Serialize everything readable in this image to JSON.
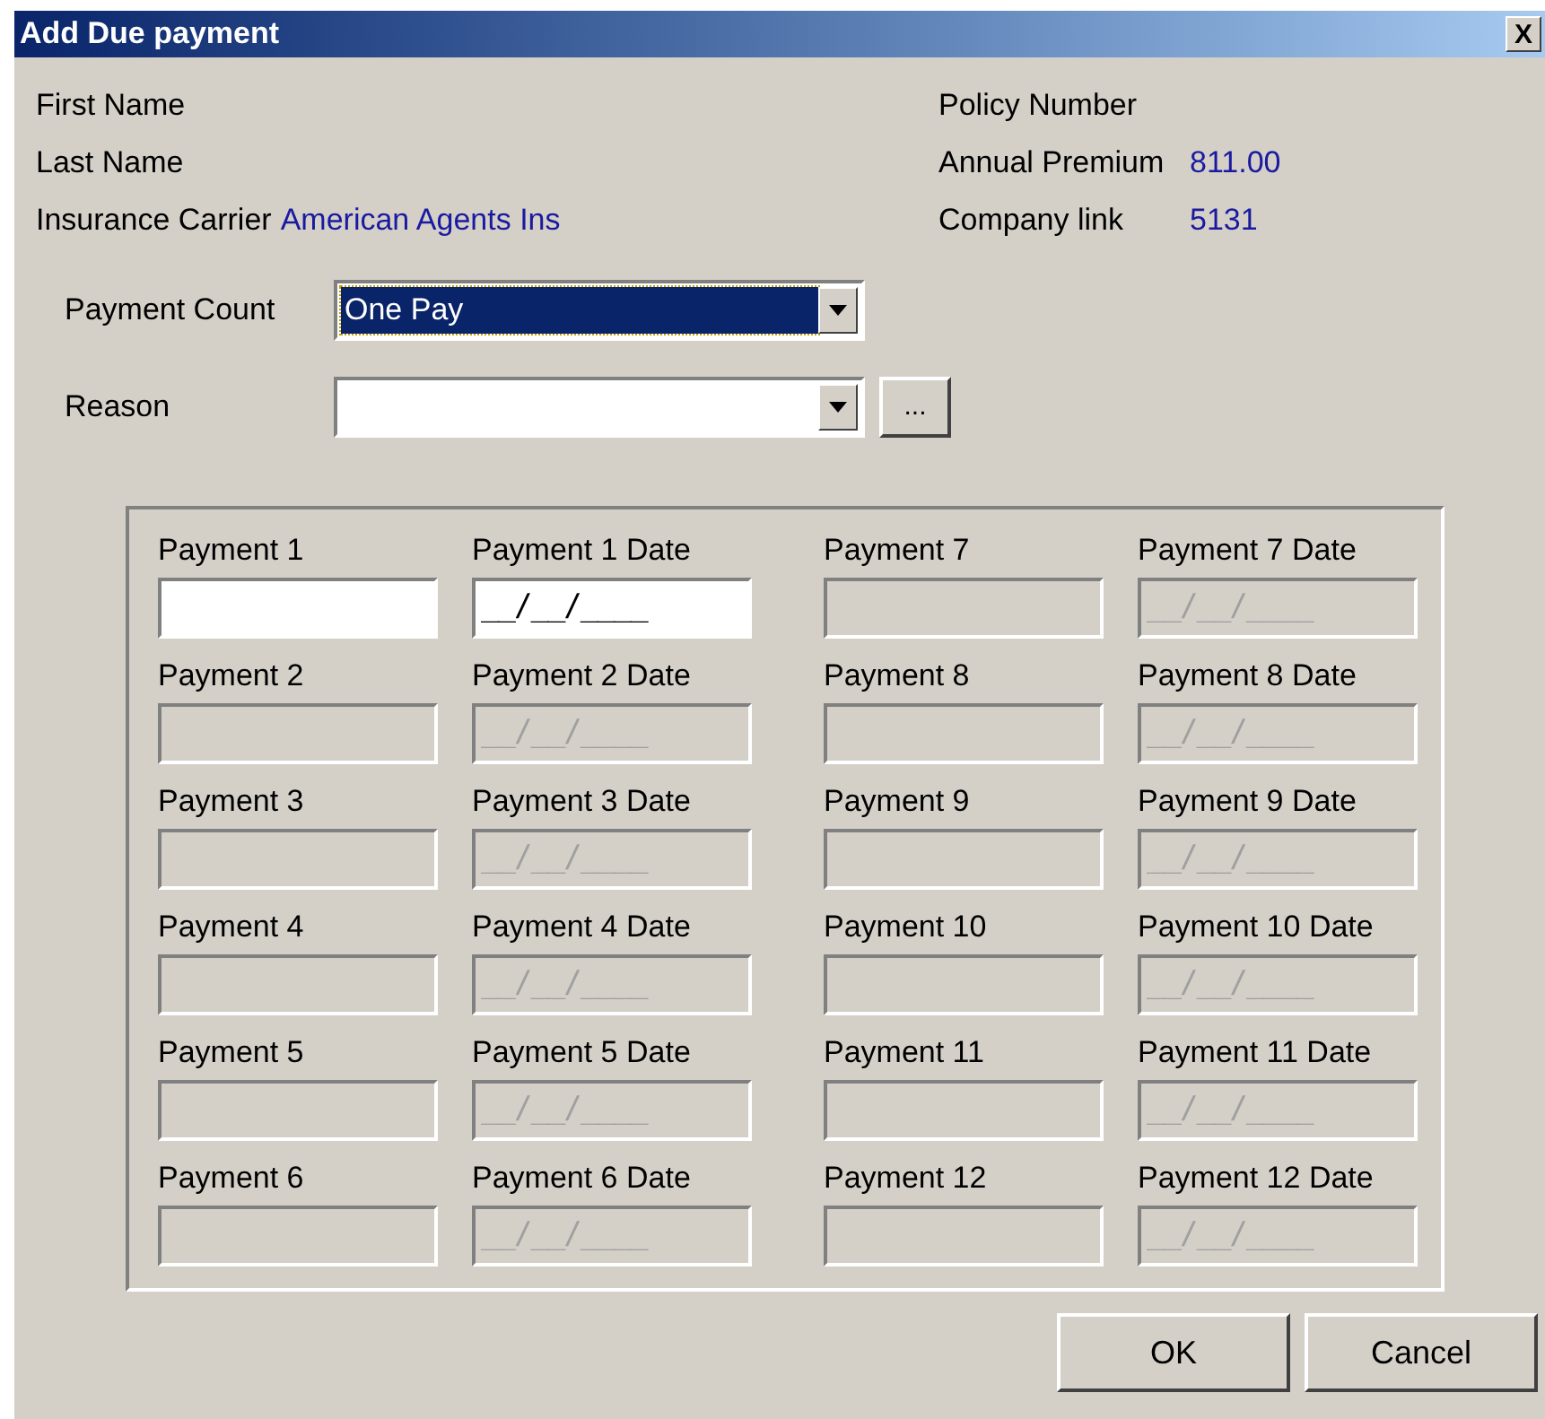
{
  "window": {
    "title": "Add Due payment",
    "close": "X"
  },
  "info_left": [
    {
      "label": "First Name"
    },
    {
      "label": "Last Name"
    },
    {
      "label": "Insurance Carrier",
      "value": "American Agents Ins"
    }
  ],
  "info_right": [
    {
      "label": "Policy Number"
    },
    {
      "label": "Annual Premium",
      "value": "811.00"
    },
    {
      "label": "Company link",
      "value": "5131"
    }
  ],
  "payment_count": {
    "label": "Payment Count",
    "value": "One Pay",
    "focused": true
  },
  "reason": {
    "label": "Reason",
    "browse": "..."
  },
  "payments": [
    {
      "label": "Payment 1",
      "date_label": "Payment 1 Date",
      "date": "__/__/____",
      "disabled": false
    },
    {
      "label": "Payment 2",
      "date_label": "Payment 2 Date",
      "date": "__/__/____",
      "disabled": true
    },
    {
      "label": "Payment 3",
      "date_label": "Payment 3 Date",
      "date": "__/__/____",
      "disabled": true
    },
    {
      "label": "Payment 4",
      "date_label": "Payment 4 Date",
      "date": "__/__/____",
      "disabled": true
    },
    {
      "label": "Payment 5",
      "date_label": "Payment 5 Date",
      "date": "__/__/____",
      "disabled": true
    },
    {
      "label": "Payment 6",
      "date_label": "Payment 6 Date",
      "date": "__/__/____",
      "disabled": true
    },
    {
      "label": "Payment 7",
      "date_label": "Payment 7 Date",
      "date": "__/__/____",
      "disabled": true
    },
    {
      "label": "Payment 8",
      "date_label": "Payment 8 Date",
      "date": "__/__/____",
      "disabled": true
    },
    {
      "label": "Payment 9",
      "date_label": "Payment 9 Date",
      "date": "__/__/____",
      "disabled": true
    },
    {
      "label": "Payment 10",
      "date_label": "Payment 10 Date",
      "date": "__/__/____",
      "disabled": true
    },
    {
      "label": "Payment 11",
      "date_label": "Payment 11 Date",
      "date": "__/__/____",
      "disabled": true
    },
    {
      "label": "Payment 12",
      "date_label": "Payment 12 Date",
      "date": "__/__/____",
      "disabled": true
    }
  ],
  "buttons": [
    "OK",
    "Cancel"
  ]
}
